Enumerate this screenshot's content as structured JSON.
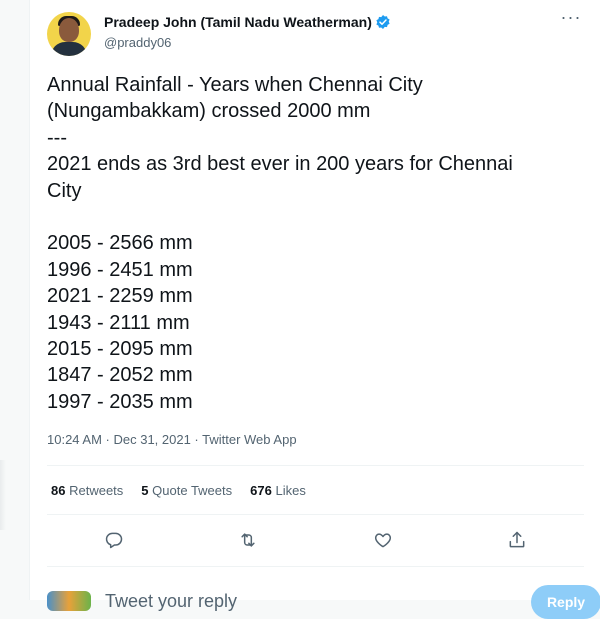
{
  "author": {
    "name": "Pradeep John (Tamil Nadu Weatherman)",
    "handle": "@praddy06"
  },
  "tweet": {
    "lines": [
      "Annual Rainfall - Years when Chennai City",
      "(Nungambakkam) crossed 2000 mm",
      "---",
      "2021 ends as 3rd best ever in 200 years for Chennai",
      "City"
    ],
    "records": [
      "2005 - 2566 mm",
      "1996 - 2451 mm",
      "2021 - 2259 mm",
      "1943 - 2111 mm",
      "2015 - 2095 mm",
      "1847 - 2052 mm",
      "1997 - 2035 mm"
    ]
  },
  "meta": "10:24 AM · Dec 31, 2021 · Twitter Web App",
  "stats": {
    "retweets_count": "86",
    "retweets_label": "Retweets",
    "quotes_count": "5",
    "quotes_label": "Quote Tweets",
    "likes_count": "676",
    "likes_label": "Likes"
  },
  "reply": {
    "placeholder": "Tweet your reply",
    "button_label": "Reply"
  },
  "colors": {
    "verified": "#1d9bf0",
    "reply_button": "#8ecdf8",
    "muted": "#536471"
  },
  "icons": [
    "more-icon",
    "verified-icon",
    "reply-icon",
    "retweet-icon",
    "like-icon",
    "share-icon"
  ]
}
